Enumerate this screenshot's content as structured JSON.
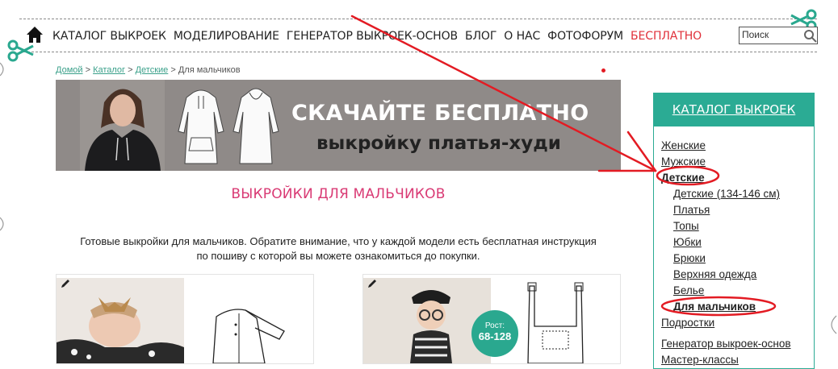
{
  "nav": {
    "items": [
      {
        "label": "КАТАЛОГ ВЫКРОЕК",
        "red": false
      },
      {
        "label": "МОДЕЛИРОВАНИЕ",
        "red": false
      },
      {
        "label": "ГЕНЕРАТОР ВЫКРОЕК-ОСНОВ",
        "red": false
      },
      {
        "label": "БЛОГ",
        "red": false
      },
      {
        "label": "О НАС",
        "red": false
      },
      {
        "label": "ФОТОФОРУМ",
        "red": false
      },
      {
        "label": "БЕСПЛАТНО",
        "red": true
      }
    ],
    "search_value": "Поиск"
  },
  "breadcrumb": {
    "home": "Домой",
    "sep1": " > ",
    "catalog": "Каталог",
    "sep2": " > ",
    "kids": "Детские",
    "sep3": " > ",
    "current": "Для мальчиков"
  },
  "banner": {
    "line1": "СКАЧАЙТЕ БЕСПЛАТНО",
    "line2": "выкройку платья-худи"
  },
  "page": {
    "title": "ВЫКРОЙКИ ДЛЯ МАЛЬЧИКОВ",
    "intro_line1": "Готовые выкройки для мальчиков. Обратите внимание, что у каждой модели есть бесплатная инструкция",
    "intro_line2": "по пошиву с которой вы можете ознакомиться до покупки."
  },
  "cards": [
    {
      "badge_label": "",
      "badge_value": ""
    },
    {
      "badge_label": "Рост:",
      "badge_value": "68-128"
    }
  ],
  "sidebar": {
    "title": "КАТАЛОГ ВЫКРОЕК",
    "items": [
      {
        "label": "Женские",
        "level": 0
      },
      {
        "label": "Мужские",
        "level": 0
      },
      {
        "label": "Детские",
        "level": 0,
        "bold": true
      },
      {
        "label": "Детские (134-146 см)",
        "level": 1
      },
      {
        "label": "Платья",
        "level": 1
      },
      {
        "label": "Топы",
        "level": 1
      },
      {
        "label": "Юбки",
        "level": 1
      },
      {
        "label": "Брюки",
        "level": 1
      },
      {
        "label": "Верхняя одежда",
        "level": 1
      },
      {
        "label": "Белье",
        "level": 1
      },
      {
        "label": "Для мальчиков",
        "level": 1,
        "bold": true
      },
      {
        "label": "Подростки",
        "level": 0
      },
      {
        "label": "Генератор выкроек-основ",
        "level": 0
      },
      {
        "label": "Мастер-классы",
        "level": 0
      }
    ]
  },
  "colors": {
    "accent": "#2bab94",
    "nav_free": "#e0303a",
    "title_pink": "#d93a74",
    "annotation_red": "#e31b23"
  }
}
